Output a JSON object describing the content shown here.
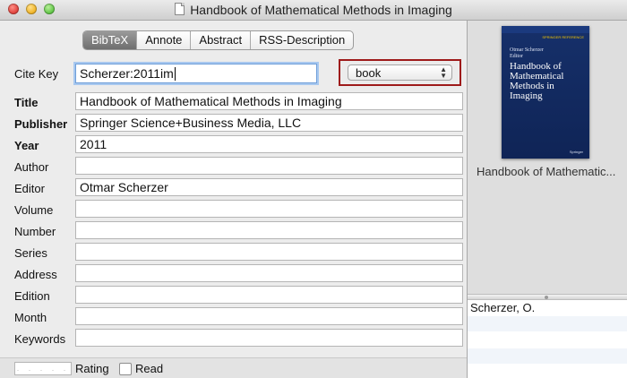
{
  "window": {
    "title": "Handbook of Mathematical Methods in Imaging"
  },
  "tabs": [
    "BibTeX",
    "Annote",
    "Abstract",
    "RSS-Description"
  ],
  "citekey": {
    "label": "Cite Key",
    "value": "Scherzer:2011im"
  },
  "entry_type": {
    "selected": "book"
  },
  "fields": {
    "title": {
      "label": "Title",
      "value": "Handbook of Mathematical Methods in Imaging"
    },
    "publisher": {
      "label": "Publisher",
      "value": "Springer Science+Business Media, LLC"
    },
    "year": {
      "label": "Year",
      "value": "2011"
    },
    "author": {
      "label": "Author",
      "value": ""
    },
    "editor": {
      "label": "Editor",
      "value": "Otmar Scherzer"
    },
    "volume": {
      "label": "Volume",
      "value": ""
    },
    "number": {
      "label": "Number",
      "value": ""
    },
    "series": {
      "label": "Series",
      "value": ""
    },
    "address": {
      "label": "Address",
      "value": ""
    },
    "edition": {
      "label": "Edition",
      "value": ""
    },
    "month": {
      "label": "Month",
      "value": ""
    },
    "keywords": {
      "label": "Keywords",
      "value": ""
    }
  },
  "bottom": {
    "rating_label": "Rating",
    "read_label": "Read",
    "rating_dots": ". . . . ."
  },
  "preview": {
    "cover_series": "SPRINGER REFERENCE",
    "cover_author": "Otmar Scherzer",
    "cover_role": "Editor",
    "cover_title": "Handbook of Mathematical Methods in Imaging",
    "cover_publisher": "Springer",
    "caption": "Handbook of Mathematic..."
  },
  "authors_list": [
    "Scherzer, O."
  ]
}
